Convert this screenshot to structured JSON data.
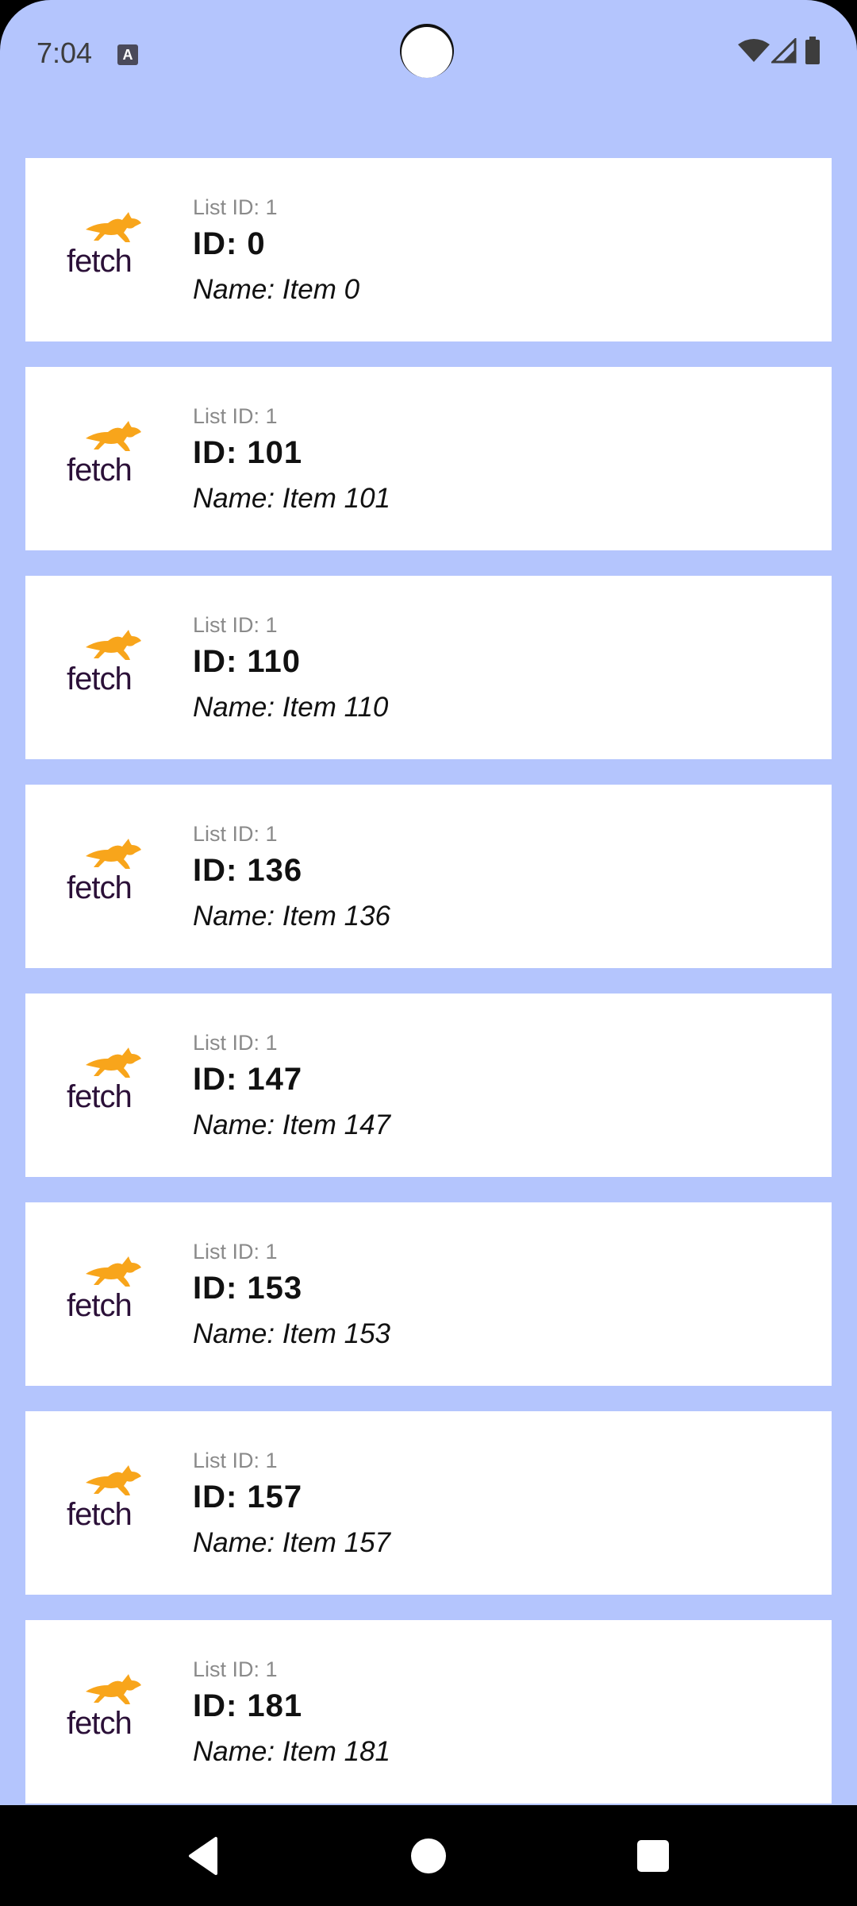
{
  "status_bar": {
    "time": "7:04",
    "notification_icon": "accessibility-a-icon",
    "icons": [
      "wifi-icon",
      "cell-signal-icon",
      "battery-icon"
    ]
  },
  "colors": {
    "background": "#b4c5fd",
    "card": "#ffffff",
    "logo_dog": "#f8a51b",
    "logo_text": "#2b1038"
  },
  "logo": {
    "text": "fetch"
  },
  "items": [
    {
      "list_id": "List ID: 1",
      "id": "ID: 0",
      "name": "Name: Item 0"
    },
    {
      "list_id": "List ID: 1",
      "id": "ID: 101",
      "name": "Name: Item 101"
    },
    {
      "list_id": "List ID: 1",
      "id": "ID: 110",
      "name": "Name: Item 110"
    },
    {
      "list_id": "List ID: 1",
      "id": "ID: 136",
      "name": "Name: Item 136"
    },
    {
      "list_id": "List ID: 1",
      "id": "ID: 147",
      "name": "Name: Item 147"
    },
    {
      "list_id": "List ID: 1",
      "id": "ID: 153",
      "name": "Name: Item 153"
    },
    {
      "list_id": "List ID: 1",
      "id": "ID: 157",
      "name": "Name: Item 157"
    },
    {
      "list_id": "List ID: 1",
      "id": "ID: 181",
      "name": "Name: Item 181"
    }
  ],
  "nav_bar": {
    "buttons": [
      "back-icon",
      "home-icon",
      "recents-icon"
    ]
  }
}
